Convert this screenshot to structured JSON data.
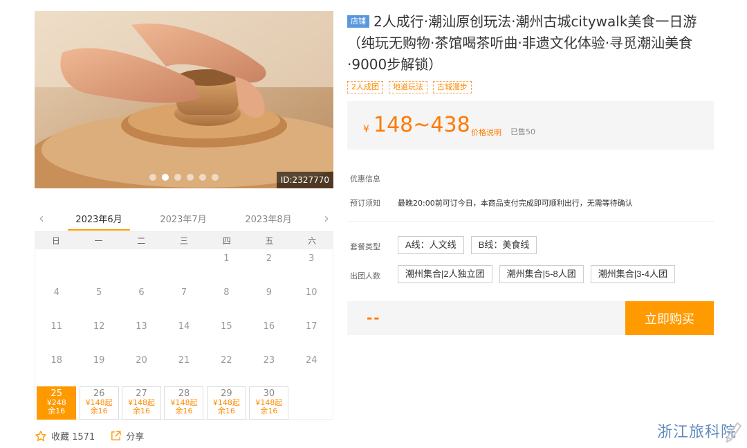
{
  "gallery": {
    "id_label": "ID:2327770",
    "dot_count": 6,
    "active_dot": 1
  },
  "calendar": {
    "months": [
      "2023年6月",
      "2023年7月",
      "2023年8月"
    ],
    "active_month": 0,
    "weekdays": [
      "日",
      "一",
      "二",
      "三",
      "四",
      "五",
      "六"
    ],
    "weeks": [
      [
        "",
        "",
        "",
        "",
        "1",
        "2",
        "3"
      ],
      [
        "4",
        "5",
        "6",
        "7",
        "8",
        "9",
        "10"
      ],
      [
        "11",
        "12",
        "13",
        "14",
        "15",
        "16",
        "17"
      ],
      [
        "18",
        "19",
        "20",
        "21",
        "22",
        "23",
        "24"
      ]
    ],
    "priced_days": [
      {
        "day": "25",
        "price": "¥248",
        "stock": "余16",
        "selected": true
      },
      {
        "day": "26",
        "price": "¥148起",
        "stock": "余16",
        "selected": false
      },
      {
        "day": "27",
        "price": "¥148起",
        "stock": "余16",
        "selected": false
      },
      {
        "day": "28",
        "price": "¥148起",
        "stock": "余16",
        "selected": false
      },
      {
        "day": "29",
        "price": "¥148起",
        "stock": "余16",
        "selected": false
      },
      {
        "day": "30",
        "price": "¥148起",
        "stock": "余16",
        "selected": false
      }
    ]
  },
  "actions": {
    "favorite_label": "收藏 1571",
    "share_label": "分享"
  },
  "product": {
    "shop_badge": "店铺",
    "title": "2人成行·潮汕原创玩法·潮州古城citywalk美食一日游（纯玩无购物·茶馆喝茶听曲·非遗文化体验·寻觅潮汕美食·9000步解锁）",
    "tags": [
      "2人成团",
      "地道玩法",
      "古城漫步"
    ],
    "currency": "¥",
    "price": "148~438",
    "price_explain": "价格说明",
    "sold": "已售50"
  },
  "info": {
    "discount_label": "优惠信息",
    "booking_label": "预订须知",
    "booking_text": "最晚20:00前可订今日，本商品支付完成即可顺利出行，无需等待确认"
  },
  "options": {
    "package_label": "套餐类型",
    "packages": [
      "A线：人文线",
      "B线：美食线"
    ],
    "group_label": "出团人数",
    "groups": [
      "潮州集合|2人独立团",
      "潮州集合|5-8人团",
      "潮州集合|3-4人团"
    ]
  },
  "buy": {
    "total_placeholder": "--",
    "button_label": "立即购买"
  },
  "watermark": {
    "text": "浙江旅科院"
  },
  "colors": {
    "accent": "#ff9a00",
    "price": "#ff7a00",
    "badge": "#5a98dd"
  }
}
